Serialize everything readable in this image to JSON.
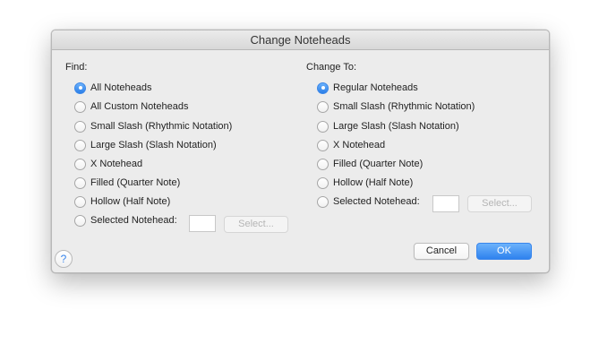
{
  "dialog": {
    "title": "Change Noteheads"
  },
  "find": {
    "label": "Find:",
    "options": [
      {
        "label": "All Noteheads",
        "selected": true
      },
      {
        "label": "All Custom Noteheads",
        "selected": false
      },
      {
        "label": "Small Slash (Rhythmic Notation)",
        "selected": false
      },
      {
        "label": "Large Slash (Slash Notation)",
        "selected": false
      },
      {
        "label": "X Notehead",
        "selected": false
      },
      {
        "label": "Filled (Quarter Note)",
        "selected": false
      },
      {
        "label": "Hollow (Half Note)",
        "selected": false
      },
      {
        "label": "Selected Notehead:",
        "selected": false
      }
    ],
    "select_button": "Select..."
  },
  "change_to": {
    "label": "Change To:",
    "options": [
      {
        "label": "Regular Noteheads",
        "selected": true
      },
      {
        "label": "Small Slash (Rhythmic Notation)",
        "selected": false
      },
      {
        "label": "Large Slash (Slash Notation)",
        "selected": false
      },
      {
        "label": "X Notehead",
        "selected": false
      },
      {
        "label": "Filled (Quarter Note)",
        "selected": false
      },
      {
        "label": "Hollow (Half Note)",
        "selected": false
      },
      {
        "label": "Selected Notehead:",
        "selected": false
      }
    ],
    "select_button": "Select..."
  },
  "buttons": {
    "cancel": "Cancel",
    "ok": "OK",
    "help": "?"
  },
  "colors": {
    "accent": "#2e82ee",
    "dialog_bg": "#ececec"
  }
}
